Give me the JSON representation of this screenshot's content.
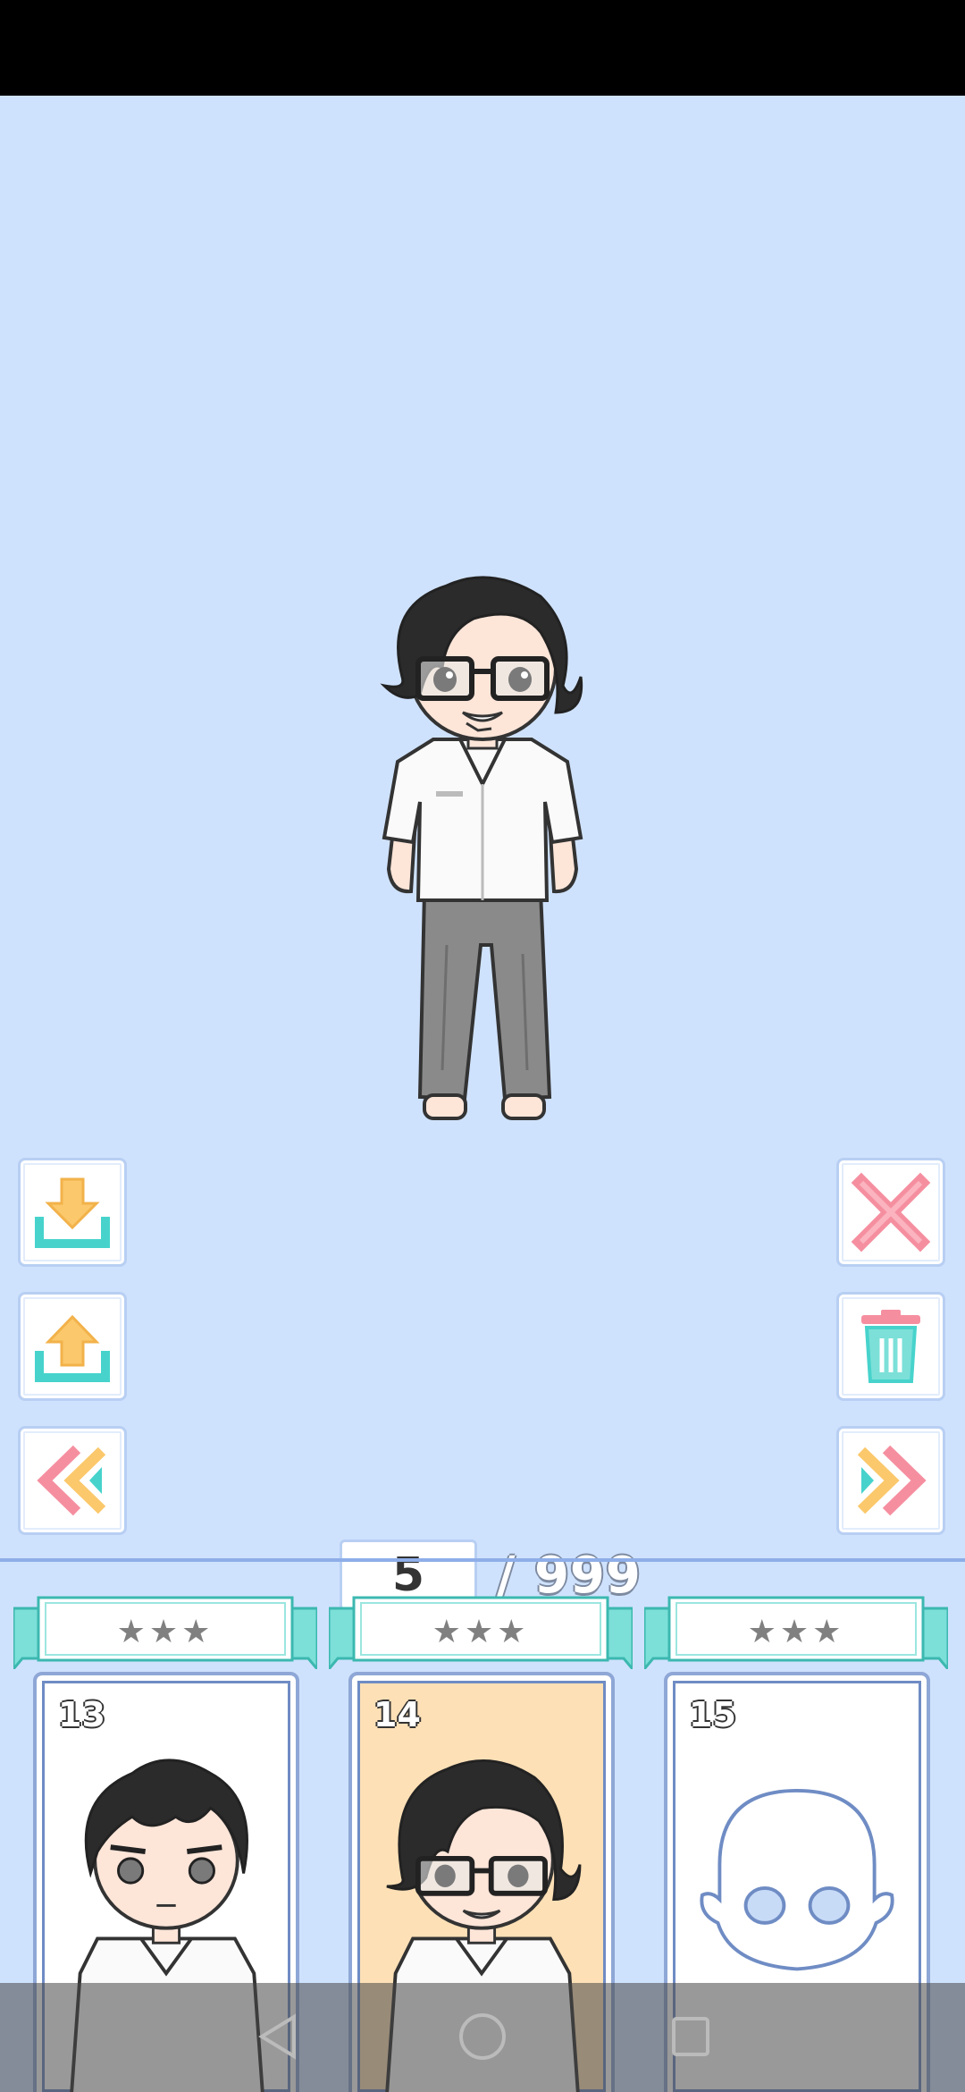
{
  "toolbar": {
    "left": [
      {
        "name": "download-icon"
      },
      {
        "name": "upload-icon"
      },
      {
        "name": "previous-page-icon"
      }
    ],
    "right": [
      {
        "name": "close-icon"
      },
      {
        "name": "trash-icon"
      },
      {
        "name": "next-page-icon"
      }
    ]
  },
  "pagination": {
    "current": "5",
    "total": "/ 999"
  },
  "slots": [
    {
      "number": "13",
      "stars": "★★★",
      "state": "boy-no-glasses"
    },
    {
      "number": "14",
      "stars": "★★★",
      "state": "boy-glasses",
      "selected": true
    },
    {
      "number": "15",
      "stars": "★★★",
      "state": "empty"
    }
  ],
  "colors": {
    "background": "#cfe2fd",
    "accent_teal": "#47d3cc",
    "accent_orange": "#fbc86b",
    "accent_pink": "#f58fa0",
    "selected_card": "#fde0b6"
  },
  "nav": [
    "back-icon",
    "home-icon",
    "recents-icon"
  ]
}
